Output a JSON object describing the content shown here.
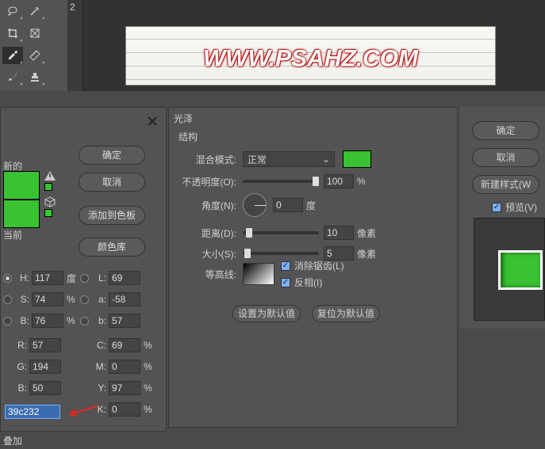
{
  "watermark": "WWW.PSAHZ.COM",
  "colorPicker": {
    "newLabel": "新的",
    "currentLabel": "当前",
    "buttons": {
      "ok": "确定",
      "cancel": "取消",
      "addSwatch": "添加到色板",
      "colorLib": "颜色库"
    },
    "hsb": {
      "h": {
        "label": "H:",
        "val": "117",
        "unit": "度"
      },
      "s": {
        "label": "S:",
        "val": "74",
        "unit": "%"
      },
      "b": {
        "label": "B:",
        "val": "76",
        "unit": "%"
      }
    },
    "lab": {
      "l": {
        "label": "L:",
        "val": "69"
      },
      "a": {
        "label": "a:",
        "val": "-58"
      },
      "b": {
        "label": "b:",
        "val": "57"
      }
    },
    "rgb": {
      "r": {
        "label": "R:",
        "val": "57"
      },
      "g": {
        "label": "G:",
        "val": "194"
      },
      "b": {
        "label": "B:",
        "val": "50"
      }
    },
    "cmyk": {
      "c": {
        "label": "C:",
        "val": "69",
        "unit": "%"
      },
      "m": {
        "label": "M:",
        "val": "0",
        "unit": "%"
      },
      "y": {
        "label": "Y:",
        "val": "97",
        "unit": "%"
      },
      "k": {
        "label": "K:",
        "val": "0",
        "unit": "%"
      }
    },
    "hex": "39c232",
    "bottomLabel": "叠加"
  },
  "layerStyle": {
    "title": "光泽",
    "section": "结构",
    "blendMode": {
      "label": "混合模式:",
      "value": "正常"
    },
    "opacity": {
      "label": "不透明度(O):",
      "value": "100",
      "unit": "%"
    },
    "angle": {
      "label": "角度(N):",
      "value": "0",
      "unit": "度"
    },
    "distance": {
      "label": "距离(D):",
      "value": "10",
      "unit": "像素"
    },
    "size": {
      "label": "大小(S):",
      "value": "5",
      "unit": "像素"
    },
    "contour": {
      "label": "等高线:",
      "antialias": "消除锯齿(L)",
      "invert": "反相(I)"
    },
    "buttons": {
      "default": "设置为默认值",
      "reset": "复位为默认值"
    }
  },
  "rightPanel": {
    "ok": "确定",
    "cancel": "取消",
    "newStyle": "新建样式(W",
    "preview": "预览(V)"
  },
  "colors": {
    "green": "#39c232"
  }
}
